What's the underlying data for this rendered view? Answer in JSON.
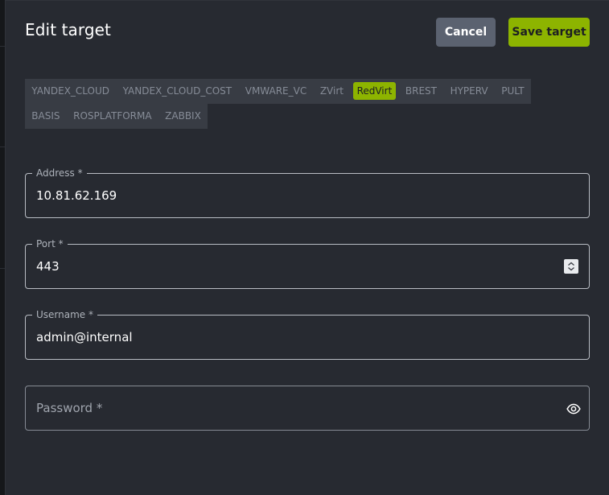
{
  "dialog": {
    "title": "Edit target",
    "cancel_label": "Cancel",
    "save_label": "Save target"
  },
  "tabs": [
    {
      "label": "YANDEX_CLOUD",
      "active": false
    },
    {
      "label": "YANDEX_CLOUD_COST",
      "active": false
    },
    {
      "label": "VMWARE_VC",
      "active": false
    },
    {
      "label": "ZVirt",
      "active": false
    },
    {
      "label": "RedVirt",
      "active": true
    },
    {
      "label": "BREST",
      "active": false
    },
    {
      "label": "HYPERV",
      "active": false
    },
    {
      "label": "PULT",
      "active": false
    },
    {
      "label": "BASIS",
      "active": false
    },
    {
      "label": "ROSPLATFORMA",
      "active": false
    },
    {
      "label": "ZABBIX",
      "active": false
    }
  ],
  "fields": {
    "address": {
      "label": "Address *",
      "value": "10.81.62.169"
    },
    "port": {
      "label": "Port *",
      "value": "443"
    },
    "username": {
      "label": "Username *",
      "value": "admin@internal"
    },
    "password": {
      "placeholder": "Password *",
      "value": ""
    }
  },
  "colors": {
    "accent": "#8db400",
    "surface": "#272a31",
    "tab_bg": "#383c44",
    "cancel_bg": "#5b6270"
  },
  "icons": {
    "port_stepper": "stepper-icon",
    "password_toggle": "eye-icon"
  }
}
